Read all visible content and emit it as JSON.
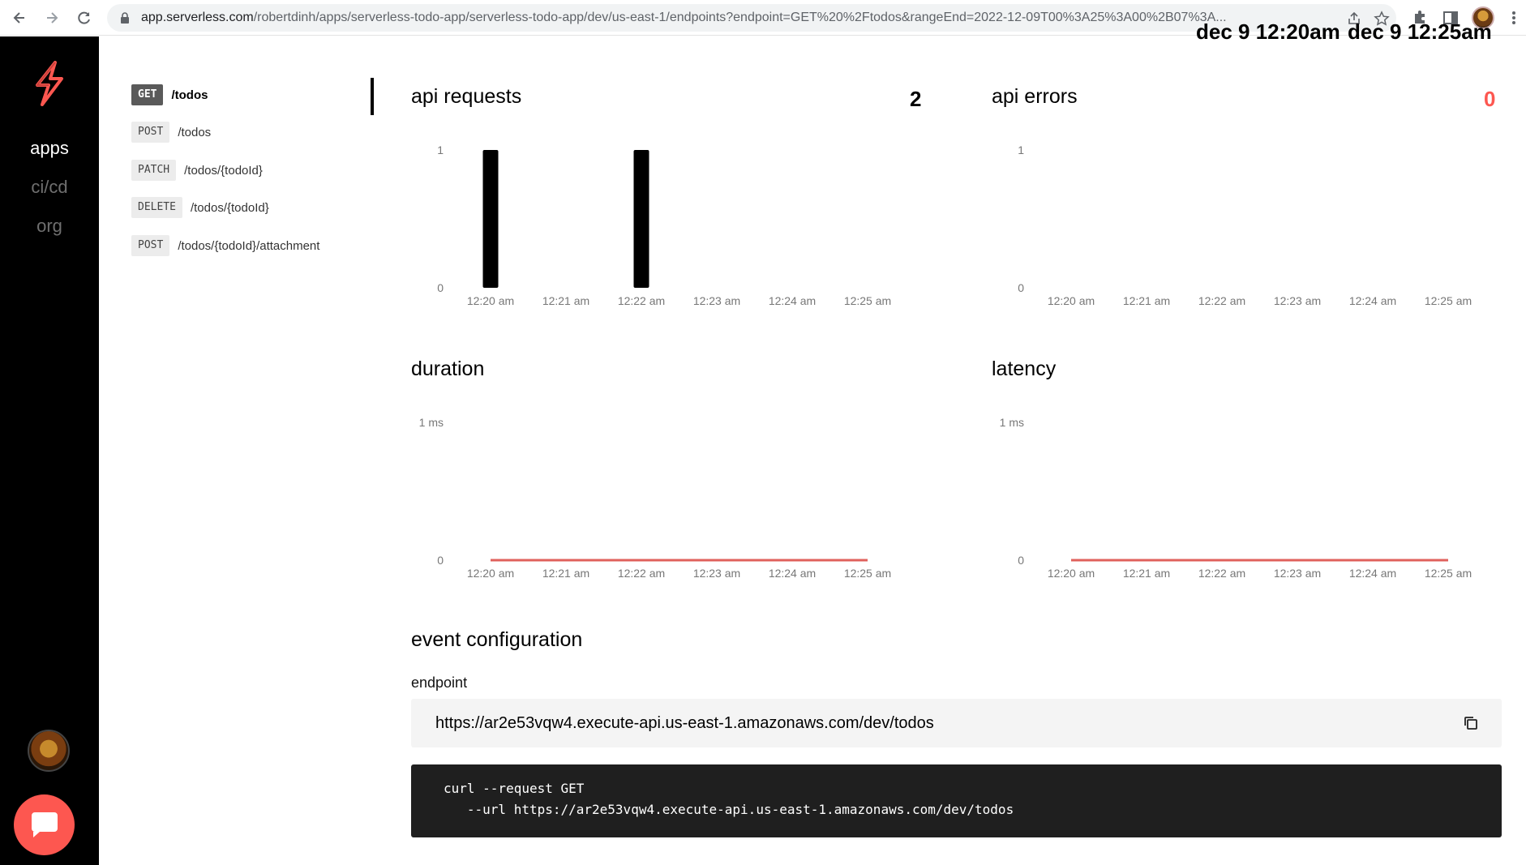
{
  "browser": {
    "url_host": "app.serverless.com",
    "url_path": "/robertdinh/apps/serverless-todo-app/serverless-todo-app/dev/us-east-1/endpoints?endpoint=GET%20%2Ftodos&rangeEnd=2022-12-09T00%3A25%3A00%2B07%3A..."
  },
  "sidebar": {
    "links": [
      {
        "label": "apps",
        "active": true
      },
      {
        "label": "ci/cd",
        "active": false
      },
      {
        "label": "org",
        "active": false
      }
    ]
  },
  "endpoints": [
    {
      "method": "GET",
      "path": "/todos",
      "active": true
    },
    {
      "method": "POST",
      "path": "/todos",
      "active": false
    },
    {
      "method": "PATCH",
      "path": "/todos/{todoId}",
      "active": false
    },
    {
      "method": "DELETE",
      "path": "/todos/{todoId}",
      "active": false
    },
    {
      "method": "POST",
      "path": "/todos/{todoId}/attachment",
      "active": false
    }
  ],
  "range": {
    "start": "dec 9 12:20am",
    "end": "dec 9 12:25am"
  },
  "panels": {
    "api_requests": {
      "title": "api requests",
      "value": "2"
    },
    "api_errors": {
      "title": "api errors",
      "value": "0"
    },
    "duration": {
      "title": "duration"
    },
    "latency": {
      "title": "latency"
    }
  },
  "colors": {
    "error_value": "#fd5750",
    "flat_line": "#e0615c",
    "bar": "#000000",
    "brand": "#fd5750"
  },
  "chart_data": [
    {
      "type": "bar",
      "title": "api requests",
      "categories": [
        "12:20 am",
        "12:21 am",
        "12:22 am",
        "12:23 am",
        "12:24 am",
        "12:25 am"
      ],
      "values": [
        1,
        0,
        1,
        0,
        0,
        0
      ],
      "y_ticks": [
        "0",
        "1"
      ],
      "ylim": [
        0,
        1
      ]
    },
    {
      "type": "bar",
      "title": "api errors",
      "categories": [
        "12:20 am",
        "12:21 am",
        "12:22 am",
        "12:23 am",
        "12:24 am",
        "12:25 am"
      ],
      "values": [
        0,
        0,
        0,
        0,
        0,
        0
      ],
      "y_ticks": [
        "0",
        "1"
      ],
      "ylim": [
        0,
        1
      ]
    },
    {
      "type": "line",
      "title": "duration",
      "categories": [
        "12:20 am",
        "12:21 am",
        "12:22 am",
        "12:23 am",
        "12:24 am",
        "12:25 am"
      ],
      "values": [
        0,
        0,
        0,
        0,
        0,
        0
      ],
      "y_ticks": [
        "0",
        "1 ms"
      ],
      "ylim": [
        0,
        1
      ]
    },
    {
      "type": "line",
      "title": "latency",
      "categories": [
        "12:20 am",
        "12:21 am",
        "12:22 am",
        "12:23 am",
        "12:24 am",
        "12:25 am"
      ],
      "values": [
        0,
        0,
        0,
        0,
        0,
        0
      ],
      "y_ticks": [
        "0",
        "1 ms"
      ],
      "ylim": [
        0,
        1
      ]
    }
  ],
  "event_configuration": {
    "title": "event configuration",
    "endpoint_label": "endpoint",
    "endpoint_url": "https://ar2e53vqw4.execute-api.us-east-1.amazonaws.com/dev/todos",
    "curl_line1": "curl --request GET",
    "curl_line2": "   --url https://ar2e53vqw4.execute-api.us-east-1.amazonaws.com/dev/todos"
  },
  "icons": {
    "back": "arrow-left-icon",
    "forward": "arrow-right-icon",
    "reload": "reload-icon",
    "lock": "lock-icon",
    "share": "share-icon",
    "star": "star-icon",
    "extensions": "puzzle-icon",
    "sidepanel": "side-panel-icon",
    "menu": "kebab-menu-icon",
    "copy": "copy-icon",
    "chat": "chat-icon"
  }
}
